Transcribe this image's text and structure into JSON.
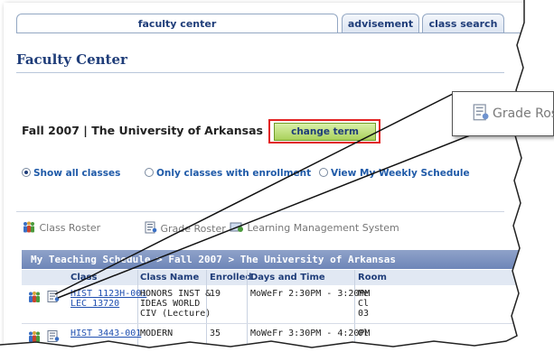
{
  "tabs": [
    {
      "label": "faculty center",
      "active": true
    },
    {
      "label": "advisement",
      "active": false
    },
    {
      "label": "class search",
      "active": false
    }
  ],
  "page_title": "Faculty Center",
  "term_text": "Fall 2007 | The University of Arkansas",
  "change_term_label": "change term",
  "radios": [
    {
      "label": "Show all classes",
      "selected": true
    },
    {
      "label": "Only classes with enrollment",
      "selected": false
    },
    {
      "label": "View My Weekly Schedule",
      "selected": false
    }
  ],
  "legend": [
    {
      "label": "Class Roster",
      "icon": "class-roster-icon"
    },
    {
      "label": "Grade Roster",
      "icon": "grade-roster-icon"
    },
    {
      "label": "Learning Management System",
      "icon": "lms-icon"
    }
  ],
  "schedule_header": "My Teaching Schedule > Fall 2007 > The University of Arkansas",
  "columns": [
    "Class",
    "Class Name",
    "Enrolled",
    "Days and Time",
    "Room"
  ],
  "rows": [
    {
      "class_line1": "HIST 1123H-001",
      "class_line2": "LEC 13720",
      "name_line1": "HONORS INST &",
      "name_line2": "IDEAS WORLD",
      "name_line3": "CIV (Lecture)",
      "enrolled": "19",
      "days_time": "MoWeFr 2:30PM - 3:20PM",
      "room_line1": "Me",
      "room_line2": "Cl",
      "room_line3": "03"
    },
    {
      "class_line1": "HIST 3443-001",
      "class_line2": "",
      "name_line1": "MODERN",
      "name_line2": "",
      "name_line3": "",
      "enrolled": "35",
      "days_time": "MoWeFr 3:30PM - 4:20PM",
      "room_line1": "Ol",
      "room_line2": "",
      "room_line3": ""
    }
  ],
  "callout_label": "Grade Roster",
  "colors": {
    "header_blue": "#1f3d79",
    "schedule_bar": "#7b91bf",
    "highlight_red": "#e22222",
    "button_green": "#a9d15c",
    "link_blue": "#1f4fb0"
  }
}
